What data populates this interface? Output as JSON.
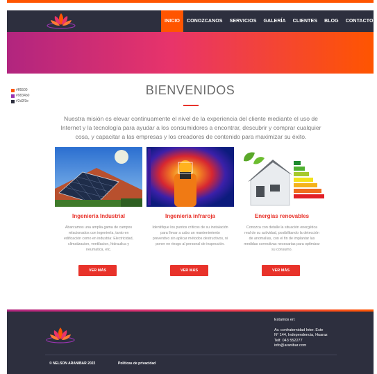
{
  "nav": {
    "items": [
      {
        "label": "INICIO",
        "active": true
      },
      {
        "label": "CONOZCANOS"
      },
      {
        "label": "SERVICIOS"
      },
      {
        "label": "GALERÍA"
      },
      {
        "label": "CLIENTES"
      },
      {
        "label": "BLOG"
      },
      {
        "label": "CONTACTO"
      }
    ]
  },
  "palette": [
    {
      "color": "#ff5500",
      "label": "#ff5500"
    },
    {
      "color": "#9834b0",
      "label": "#9834b0"
    },
    {
      "color": "#2d2f3e",
      "label": "#2d2f3e"
    }
  ],
  "main": {
    "title": "BIENVENIDOS",
    "mission": "Nuestra misión es elevar continuamente el nivel de la experiencia del cliente mediante el uso de Internet y la tecnología para ayudar a los consumidores a encontrar, descubrir y comprar cualquier cosa, y capacitar a las empresas y los creadores de contenido para maximizar su éxito."
  },
  "cards": [
    {
      "title": "Ingeniería Industrial",
      "text": "Abarcamos una amplia gama de campos relacionados con ingeniería, tanto en edificación como en industria: Electricidad, climatizacion, ventilacion, hidraulica y neumatica, etc.",
      "button": "VER MÁS",
      "image": "solar-panels-image"
    },
    {
      "title": "Ingeniería infraroja",
      "text": "Identifique los puntos críticos de su instalación para llevar a cabo un mantenimiento preventivo sin aplicar métodos destructivos, ni poner en riesgo al personal de inspección.",
      "button": "VER MÁS",
      "image": "thermal-camera-image"
    },
    {
      "title": "Energías renovables",
      "text": "Conozca con detalle la situación energética real de su actividad, posibilitando la detección de anomalías, con el fin de implantar las medidas correctivas necesarias para optimizar su consumo.",
      "button": "VER MÁS",
      "image": "energy-rating-image"
    }
  ],
  "footer": {
    "contact_heading": "Estamos en:",
    "address_line1": "Av. confraternidad Inter. Este",
    "address_line2": "N° 144, Independencia, Huaraz",
    "phone": "Telf. 043 552277",
    "email": "info@aranibar.com",
    "copyright": "© NELSON ARANIBAR 2022",
    "privacy": "Políticas de privacidad"
  },
  "colors": {
    "accent": "#ff5500",
    "red": "#e8322a",
    "purple": "#9834b0",
    "dark": "#2d2f3e"
  }
}
